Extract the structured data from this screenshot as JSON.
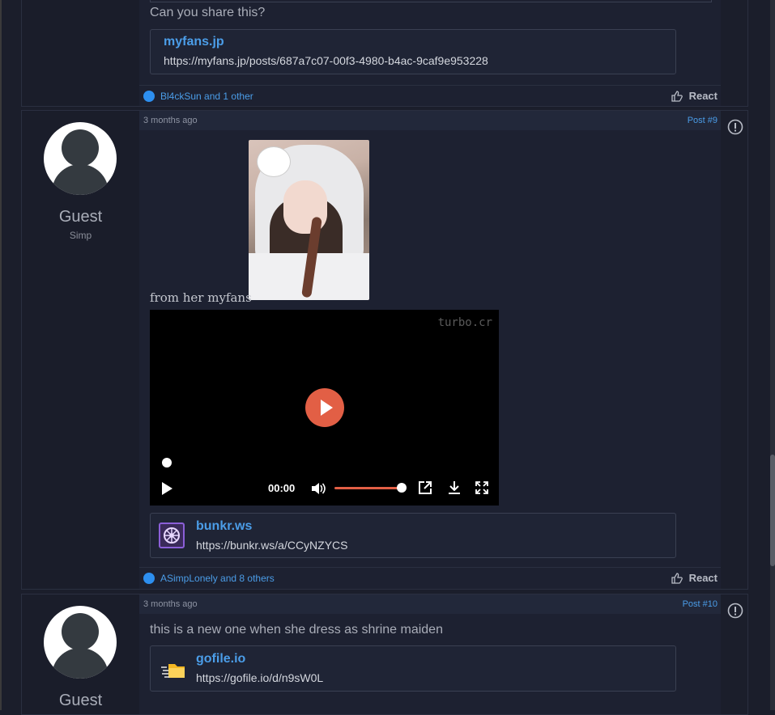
{
  "post_8": {
    "message": "Can you share this?",
    "link": {
      "site": "myfans.jp",
      "url": "https://myfans.jp/posts/687a7c07-00f3-4980-b4ac-9caf9e953228"
    },
    "reactions": "Bl4ckSun and 1 other",
    "react_label": "React"
  },
  "post_9": {
    "time": "3 months ago",
    "number": "Post #9",
    "user": {
      "name": "Guest",
      "title": "Simp"
    },
    "caption": "from her myfans",
    "video": {
      "watermark": "turbo.cr",
      "time": "00:00",
      "volume": 1.0
    },
    "link": {
      "site": "bunkr.ws",
      "url": "https://bunkr.ws/a/CCyNZYCS"
    },
    "reactions": "ASimpLonely and 8 others",
    "react_label": "React"
  },
  "post_10": {
    "time": "3 months ago",
    "number": "Post #10",
    "user": {
      "name": "Guest"
    },
    "message": "this is a new one when she dress as shrine maiden",
    "link": {
      "site": "gofile.io",
      "url": "https://gofile.io/d/n9sW0L"
    }
  },
  "colors": {
    "accent": "#4b9de8",
    "play_button": "#e25f45",
    "background": "#1b1e2b"
  },
  "icons": [
    "report-icon",
    "thumbs-up-icon",
    "play-icon",
    "volume-icon",
    "popout-icon",
    "download-icon",
    "fullscreen-icon",
    "bunkr-logo-icon",
    "gofile-logo-icon"
  ]
}
